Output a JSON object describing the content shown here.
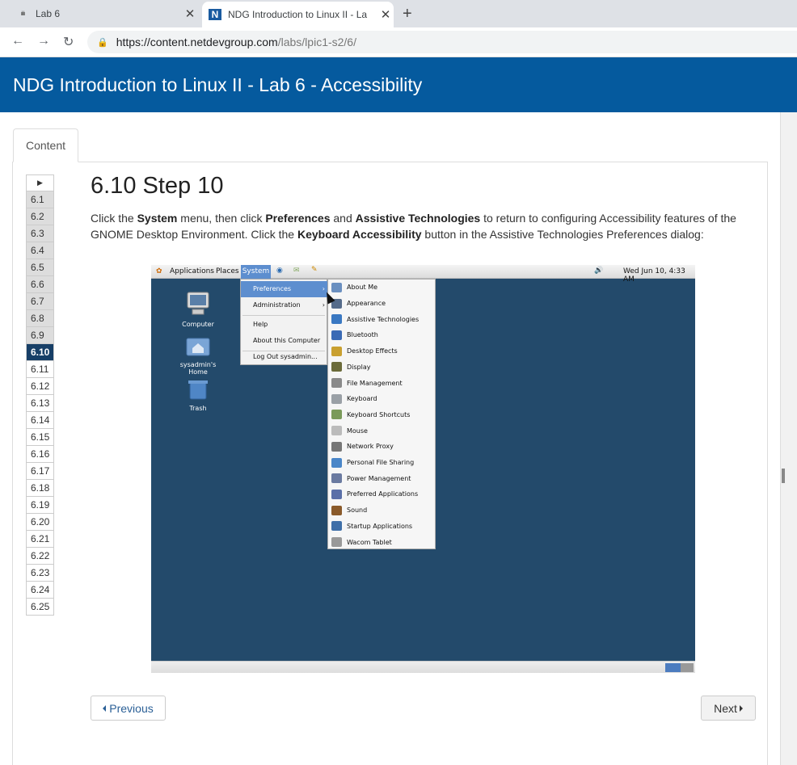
{
  "browser": {
    "tabs": [
      {
        "title": "Lab 6"
      },
      {
        "title": "NDG Introduction to Linux II - La"
      }
    ],
    "url_host": "https://content.netdevgroup.com",
    "url_path": "/labs/lpic1-s2/6/"
  },
  "header": {
    "title": "NDG Introduction to Linux II - Lab 6 - Accessibility"
  },
  "content_tab": "Content",
  "steps": [
    "6.1",
    "6.2",
    "6.3",
    "6.4",
    "6.5",
    "6.6",
    "6.7",
    "6.8",
    "6.9",
    "6.10",
    "6.11",
    "6.12",
    "6.13",
    "6.14",
    "6.15",
    "6.16",
    "6.17",
    "6.18",
    "6.19",
    "6.20",
    "6.21",
    "6.22",
    "6.23",
    "6.24",
    "6.25"
  ],
  "current_step": "6.10",
  "step": {
    "title": "6.10 Step 10",
    "text": {
      "p1": "Click the ",
      "b1": "System",
      "p2": " menu, then click ",
      "b2": "Preferences",
      "p3": " and ",
      "b3": "Assistive Technologies",
      "p4": " to return to configuring Accessibility features of the GNOME Desktop Environment. Click the ",
      "b4": "Keyboard Accessibility",
      "p5": " button in the Assistive Technologies Preferences dialog:"
    }
  },
  "screenshot": {
    "panel": {
      "applications": "Applications",
      "places": "Places",
      "system": "System",
      "clock": "Wed Jun 10,  4:33 AM"
    },
    "desktop_icons": [
      "Computer",
      "sysadmin's Home",
      "Trash"
    ],
    "system_menu": [
      "Preferences",
      "Administration",
      "Help",
      "About this Computer",
      "Log Out sysadmin..."
    ],
    "preferences_menu": [
      "About Me",
      "Appearance",
      "Assistive Technologies",
      "Bluetooth",
      "Desktop Effects",
      "Display",
      "File Management",
      "Keyboard",
      "Keyboard Shortcuts",
      "Mouse",
      "Network Proxy",
      "Personal File Sharing",
      "Power Management",
      "Preferred Applications",
      "Sound",
      "Startup Applications",
      "Wacom Tablet"
    ]
  },
  "buttons": {
    "previous": "Previous",
    "next": "Next"
  },
  "colors": {
    "header": "#055a9e",
    "active_step": "#173f67",
    "desktop": "#234a6b"
  }
}
